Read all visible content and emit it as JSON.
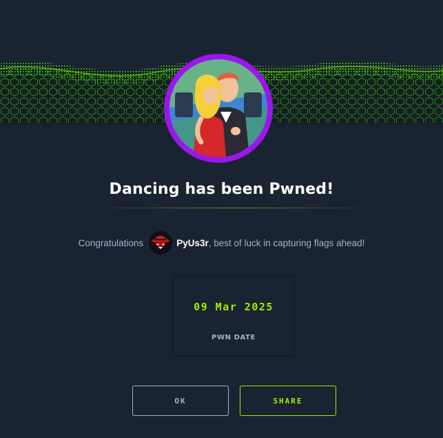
{
  "colors": {
    "background": "#1a2332",
    "accent_green": "#9fef00",
    "ring_purple": "#9a16ec",
    "muted_text": "#a4b1cd",
    "title_text": "#ffffff"
  },
  "banner": {
    "icon": "green-hexagon-wave-graphic"
  },
  "machine": {
    "avatar_icon": "dancing-couple-avatar"
  },
  "title": "Dancing has been Pwned!",
  "congrats": {
    "prefix": "Congratulations",
    "user_avatar_icon": "red-hat-hacker-avatar",
    "username": "PyUs3r",
    "suffix": ", best of luck in capturing flags ahead!"
  },
  "pwn_card": {
    "date": "09 Mar 2025",
    "label": "PWN DATE"
  },
  "buttons": {
    "ok_label": "OK",
    "share_label": "SHARE"
  }
}
